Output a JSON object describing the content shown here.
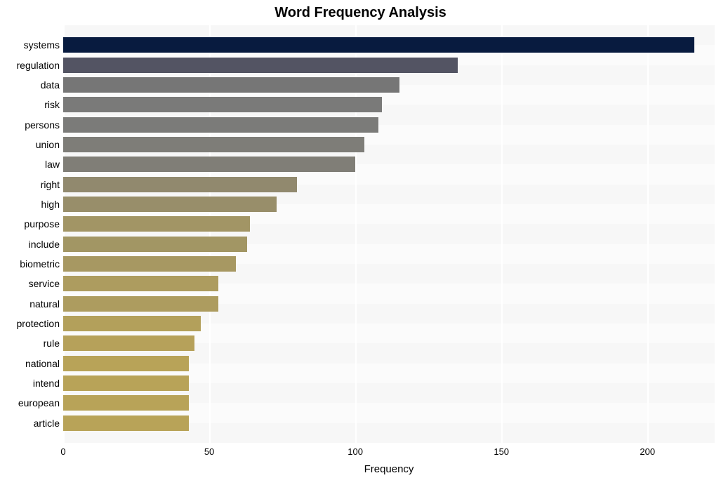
{
  "chart_data": {
    "type": "bar",
    "title": "Word Frequency Analysis",
    "xlabel": "Frequency",
    "ylabel": "",
    "xlim": [
      0,
      223
    ],
    "x_ticks": [
      0,
      50,
      100,
      150,
      200
    ],
    "categories": [
      "systems",
      "regulation",
      "data",
      "risk",
      "persons",
      "union",
      "law",
      "right",
      "high",
      "purpose",
      "include",
      "biometric",
      "service",
      "natural",
      "protection",
      "rule",
      "national",
      "intend",
      "european",
      "article"
    ],
    "values": [
      216,
      135,
      115,
      109,
      108,
      103,
      100,
      80,
      73,
      64,
      63,
      59,
      53,
      53,
      47,
      45,
      43,
      43,
      43,
      43
    ],
    "bar_colors": [
      "#081b3f",
      "#535463",
      "#767676",
      "#7a7a79",
      "#7b7b79",
      "#7e7d78",
      "#807e77",
      "#91896e",
      "#988e6a",
      "#a29565",
      "#a29664",
      "#a79862",
      "#ad9c5f",
      "#ad9c5f",
      "#b3a05b",
      "#b6a15a",
      "#b8a358",
      "#b8a358",
      "#b8a358",
      "#b8a358"
    ]
  }
}
